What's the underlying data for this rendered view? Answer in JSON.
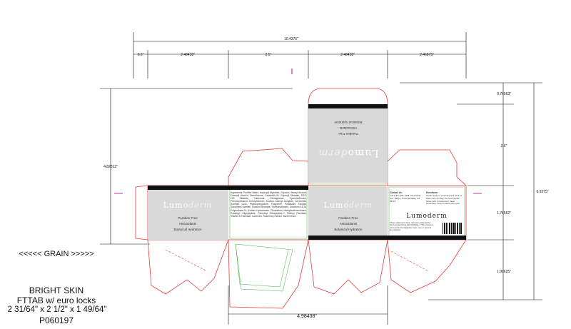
{
  "dimensions": {
    "overall_width": "10.4375\"",
    "glue_flap": "0.5\"",
    "panel_1": "2.48438\"",
    "panel_2": "2.5\"",
    "panel_3": "2.48438\"",
    "panel_4": "2.46875\"",
    "left_height": "4.82812\"",
    "right_top": "0.76563\"",
    "right_mid": "2.5\"",
    "right_overall": "6.9375\"",
    "right_panel": "1.76562\"",
    "right_bottom": "1.90625\"",
    "bottom_width": "4.98438\""
  },
  "panels": {
    "front_left": {
      "brand_prefix": "Lumo",
      "brand_suffix": "derm",
      "claims": [
        "Paraben Free",
        "Antioxidants",
        "Botanical Hydration"
      ]
    },
    "ingredients": {
      "text": "Ingredients: Purified Water, Isopropyl Myristate, Glycerin, Stearyl Alcohol, Cetearyl Alcohol, Dimethicone, Ceteareth-20, Glyceryl Stearate, PEG-100 Stearate, Carbomer, Carrageenan, Cyclomethicone, Phenoxyethanol, Chlorphenesin, Sodium Lauroyl Lactylate, Ceramides, Xanthan Gum, Phytosphingosine, Fragrance, Potassium Sorbate, Tocopheryl Acetate, Sodium Benzoate, Triethanolamine, Disodium EDTA, Polysorbate 20, Sodium Hyaluronate, Cholesterol, Methylisothiazolinone, Palmitoyl Oligopeptide, Palmitoyl Tetrapeptide-7, Retinyl Palmitate, Vitamin A Palmitate, Lavender, Rosemary Extract, Bark Extract."
    },
    "front_right": {
      "brand_prefix": "Lumo",
      "brand_suffix": "derm",
      "claims": [
        "Paraben Free",
        "Antioxidants",
        "Botanical Hydration"
      ]
    },
    "info": {
      "contact_title": "Contact Us:",
      "contact_text": "Call 1-877-251-7818 7734 Tokay Ave, Bldg A, Prescott Valley, AZ 86314",
      "directions_title": "Directions:",
      "directions_text": "Gently apply to your face and neck at least once per day. For best results follow with a moisturizer. Wear sunscreen. Avoid contact with eyes.",
      "brand": "Lumoderm",
      "disclaimer": "These statements have not been evaluated by the Food and Drug Administration. This product is not intended to diagnose, treat, cure or prevent any disease."
    },
    "top_flap": {
      "brand_prefix": "Lumo",
      "brand_suffix": "derm",
      "claims": [
        "Paraben Free",
        "Antioxidants",
        "Botanical Hydration"
      ]
    }
  },
  "notes": {
    "grain": "<<<<< GRAIN >>>>>",
    "product": "BRIGHT SKIN",
    "style": "FTTAB w/ euro locks",
    "size": "2 31/64\" x 2 1/2\" x 1 49/64\"",
    "code": "P060197"
  },
  "colors": {
    "cut_line": "#e23b3b",
    "bleed_line": "#3cb043",
    "panel_grey": "#d9d9d9",
    "band_black": "#111111",
    "brand_accent": "#e3e3e3"
  }
}
